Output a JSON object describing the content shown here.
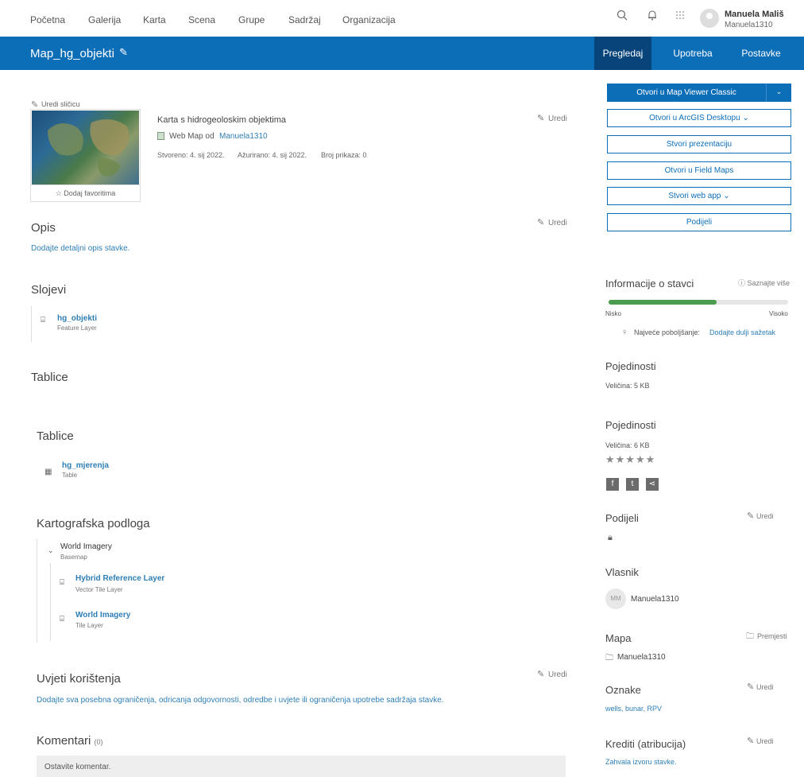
{
  "nav": {
    "items": [
      "Početna",
      "Galerija",
      "Karta",
      "Scena",
      "Grupe",
      "Sadržaj",
      "Organizacija"
    ],
    "user_name": "Manuela Mališ",
    "user_handle": "Manuela1310"
  },
  "titlebar": {
    "title": "Map_hg_objekti",
    "tabs": [
      "Pregledaj",
      "Upotreba",
      "Postavke"
    ]
  },
  "summary": {
    "edit_thumb": "Uredi sličicu",
    "description": "Karta s hidrogeoloskim objektima",
    "type_prefix": "Web Map od",
    "owner_link": "Manuela1310",
    "created": "Stvoreno: 4. sij 2022.",
    "updated": "Ažurirano: 4. sij 2022.",
    "views": "Broj prikaza: 0",
    "add_favorite": "Dodaj favoritima",
    "edit": "Uredi"
  },
  "opis": {
    "heading": "Opis",
    "add_text": "Dodajte detaljni opis stavke.",
    "edit": "Uredi"
  },
  "slojevi": {
    "heading": "Slojevi",
    "layer_name": "hg_objekti",
    "layer_type": "Feature Layer"
  },
  "tablice": {
    "heading": "Tablice",
    "sub_heading": "Tablice",
    "table_name": "hg_mjerenja",
    "table_type": "Table"
  },
  "basemap": {
    "heading": "Kartografska podloga",
    "name": "World Imagery",
    "type": "Basemap",
    "layers": [
      {
        "name": "Hybrid Reference Layer",
        "type": "Vector Tile Layer"
      },
      {
        "name": "World Imagery",
        "type": "Tile Layer"
      }
    ]
  },
  "terms": {
    "heading": "Uvjeti korištenja",
    "add_text": "Dodajte sva posebna ograničenja, odricanja odgovornosti, odredbe i uvjete ili ograničenja upotrebe sadržaja stavke.",
    "edit": "Uredi"
  },
  "comments": {
    "heading": "Komentari",
    "count": "(0)",
    "placeholder": "Ostavite komentar."
  },
  "actions": {
    "open_mv": "Otvori u Map Viewer Classic",
    "open_desktop": "Otvori u ArcGIS Desktopu",
    "create_presentation": "Stvori prezentaciju",
    "open_field_maps": "Otvori u Field Maps",
    "create_web_app": "Stvori web app",
    "share": "Podijeli"
  },
  "info": {
    "heading": "Informacije o stavci",
    "learn_more": "Saznajte više",
    "low": "Nisko",
    "high": "Visoko",
    "progress": 0.6,
    "tip_label": "Najveće poboljšanje:",
    "tip_link": "Dodajte dulji sažetak"
  },
  "details1": {
    "heading": "Pojedinosti",
    "size": "Veličina: 5 KB"
  },
  "details2": {
    "heading": "Pojedinosti",
    "size": "Veličina: 6 KB",
    "stars": "★★★★★"
  },
  "share_section": {
    "heading": "Podijeli",
    "edit": "Uredi"
  },
  "owner": {
    "heading": "Vlasnik",
    "initials": "MM",
    "name": "Manuela1310"
  },
  "folder": {
    "heading": "Mapa",
    "move": "Premjesti",
    "name": "Manuela1310"
  },
  "tags": {
    "heading": "Oznake",
    "edit": "Uredi",
    "values": "wells, bunar, RPV"
  },
  "credits": {
    "heading": "Krediti (atribucija)",
    "edit": "Uredi",
    "add_text": "Zahvala izvoru stavke."
  },
  "colors": {
    "brand": "#0d6eb8",
    "active_tab": "#08447a",
    "link": "#2e7fb5",
    "progress": "#4b9c4e"
  }
}
